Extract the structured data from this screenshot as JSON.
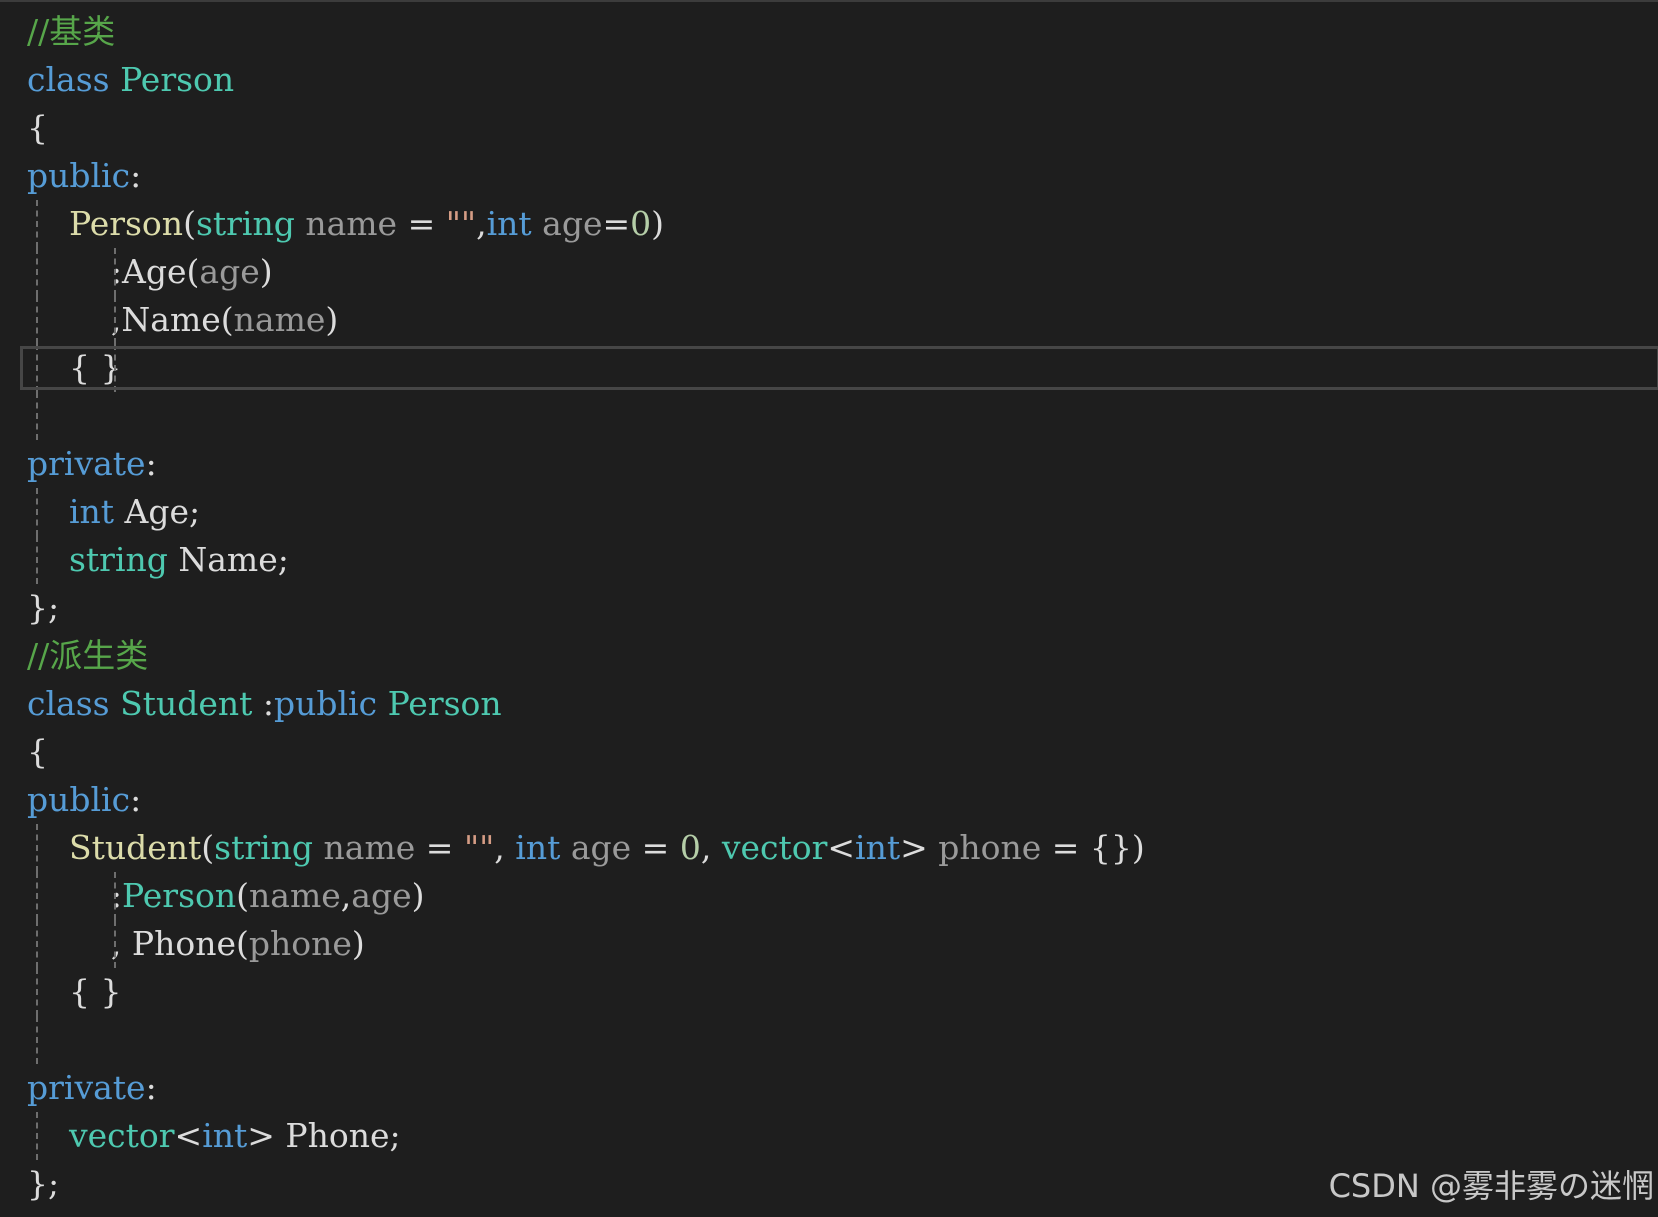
{
  "watermark": "CSDN @雾非雾の迷惘",
  "colors": {
    "background": "#1e1e1e",
    "keyword": "#569cd6",
    "type": "#4ec9b0",
    "comment": "#57a64a",
    "function": "#dcdcaa",
    "parameter": "#9a9a9a",
    "number": "#b5cea8",
    "string": "#d69d85",
    "plain": "#dcdcdc"
  },
  "current_line": 7,
  "lines": [
    {
      "guides": [],
      "tokens": [
        {
          "t": "//基类",
          "c": "cmt"
        }
      ]
    },
    {
      "guides": [],
      "tokens": [
        {
          "t": "class ",
          "c": "kw"
        },
        {
          "t": "Person",
          "c": "type"
        }
      ]
    },
    {
      "guides": [],
      "tokens": [
        {
          "t": "{",
          "c": "plain"
        }
      ]
    },
    {
      "guides": [],
      "tokens": [
        {
          "t": "public",
          "c": "kw"
        },
        {
          "t": ":",
          "c": "plain"
        }
      ]
    },
    {
      "guides": [
        1
      ],
      "tokens": [
        {
          "t": "    ",
          "c": "plain"
        },
        {
          "t": "Person",
          "c": "fn"
        },
        {
          "t": "(",
          "c": "plain"
        },
        {
          "t": "string",
          "c": "type"
        },
        {
          "t": " name",
          "c": "param"
        },
        {
          "t": " = ",
          "c": "plain"
        },
        {
          "t": "\"\"",
          "c": "str"
        },
        {
          "t": ",",
          "c": "plain"
        },
        {
          "t": "int",
          "c": "kw"
        },
        {
          "t": " age",
          "c": "param"
        },
        {
          "t": "=",
          "c": "plain"
        },
        {
          "t": "0",
          "c": "num"
        },
        {
          "t": ")",
          "c": "plain"
        }
      ]
    },
    {
      "guides": [
        1,
        2
      ],
      "tokens": [
        {
          "t": "        ",
          "c": "plain"
        },
        {
          "t": ":Age",
          "c": "plain"
        },
        {
          "t": "(",
          "c": "plain"
        },
        {
          "t": "age",
          "c": "param"
        },
        {
          "t": ")",
          "c": "plain"
        }
      ]
    },
    {
      "guides": [
        1,
        2
      ],
      "tokens": [
        {
          "t": "        ",
          "c": "plain"
        },
        {
          "t": ",Name",
          "c": "plain"
        },
        {
          "t": "(",
          "c": "plain"
        },
        {
          "t": "name",
          "c": "param"
        },
        {
          "t": ")",
          "c": "plain"
        }
      ]
    },
    {
      "guides": [
        1,
        2
      ],
      "tokens": [
        {
          "t": "    ",
          "c": "plain"
        },
        {
          "t": "{ }",
          "c": "plain"
        }
      ]
    },
    {
      "guides": [
        1
      ],
      "tokens": []
    },
    {
      "guides": [],
      "tokens": [
        {
          "t": "private",
          "c": "kw"
        },
        {
          "t": ":",
          "c": "plain"
        }
      ]
    },
    {
      "guides": [
        1
      ],
      "tokens": [
        {
          "t": "    ",
          "c": "plain"
        },
        {
          "t": "int",
          "c": "kw"
        },
        {
          "t": " Age;",
          "c": "plain"
        }
      ]
    },
    {
      "guides": [
        1
      ],
      "tokens": [
        {
          "t": "    ",
          "c": "plain"
        },
        {
          "t": "string",
          "c": "type"
        },
        {
          "t": " Name;",
          "c": "plain"
        }
      ]
    },
    {
      "guides": [],
      "tokens": [
        {
          "t": "};",
          "c": "plain"
        }
      ]
    },
    {
      "guides": [],
      "tokens": [
        {
          "t": "//派生类",
          "c": "cmt"
        }
      ]
    },
    {
      "guides": [],
      "tokens": [
        {
          "t": "class ",
          "c": "kw"
        },
        {
          "t": "Student",
          "c": "type"
        },
        {
          "t": " :",
          "c": "plain"
        },
        {
          "t": "public",
          "c": "kw"
        },
        {
          "t": " ",
          "c": "plain"
        },
        {
          "t": "Person",
          "c": "type"
        }
      ]
    },
    {
      "guides": [],
      "tokens": [
        {
          "t": "{",
          "c": "plain"
        }
      ]
    },
    {
      "guides": [],
      "tokens": [
        {
          "t": "public",
          "c": "kw"
        },
        {
          "t": ":",
          "c": "plain"
        }
      ]
    },
    {
      "guides": [
        1
      ],
      "tokens": [
        {
          "t": "    ",
          "c": "plain"
        },
        {
          "t": "Student",
          "c": "fn"
        },
        {
          "t": "(",
          "c": "plain"
        },
        {
          "t": "string",
          "c": "type"
        },
        {
          "t": " name",
          "c": "param"
        },
        {
          "t": " = ",
          "c": "plain"
        },
        {
          "t": "\"\"",
          "c": "str"
        },
        {
          "t": ", ",
          "c": "plain"
        },
        {
          "t": "int",
          "c": "kw"
        },
        {
          "t": " age",
          "c": "param"
        },
        {
          "t": " = ",
          "c": "plain"
        },
        {
          "t": "0",
          "c": "num"
        },
        {
          "t": ", ",
          "c": "plain"
        },
        {
          "t": "vector",
          "c": "type"
        },
        {
          "t": "<",
          "c": "plain"
        },
        {
          "t": "int",
          "c": "kw"
        },
        {
          "t": ">",
          "c": "plain"
        },
        {
          "t": " phone",
          "c": "param"
        },
        {
          "t": " = {})",
          "c": "plain"
        }
      ]
    },
    {
      "guides": [
        1,
        2
      ],
      "tokens": [
        {
          "t": "        ",
          "c": "plain"
        },
        {
          "t": ":",
          "c": "plain"
        },
        {
          "t": "Person",
          "c": "type"
        },
        {
          "t": "(",
          "c": "plain"
        },
        {
          "t": "name",
          "c": "param"
        },
        {
          "t": ",",
          "c": "plain"
        },
        {
          "t": "age",
          "c": "param"
        },
        {
          "t": ")",
          "c": "plain"
        }
      ]
    },
    {
      "guides": [
        1,
        2
      ],
      "tokens": [
        {
          "t": "        ",
          "c": "plain"
        },
        {
          "t": ", Phone",
          "c": "plain"
        },
        {
          "t": "(",
          "c": "plain"
        },
        {
          "t": "phone",
          "c": "param"
        },
        {
          "t": ")",
          "c": "plain"
        }
      ]
    },
    {
      "guides": [
        1
      ],
      "tokens": [
        {
          "t": "    ",
          "c": "plain"
        },
        {
          "t": "{ }",
          "c": "plain"
        }
      ]
    },
    {
      "guides": [
        1
      ],
      "tokens": []
    },
    {
      "guides": [],
      "tokens": [
        {
          "t": "private",
          "c": "kw"
        },
        {
          "t": ":",
          "c": "plain"
        }
      ]
    },
    {
      "guides": [
        1
      ],
      "tokens": [
        {
          "t": "    ",
          "c": "plain"
        },
        {
          "t": "vector",
          "c": "type"
        },
        {
          "t": "<",
          "c": "plain"
        },
        {
          "t": "int",
          "c": "kw"
        },
        {
          "t": ">",
          "c": "plain"
        },
        {
          "t": " Phone;",
          "c": "plain"
        }
      ]
    },
    {
      "guides": [],
      "tokens": [
        {
          "t": "};",
          "c": "plain"
        }
      ]
    }
  ]
}
